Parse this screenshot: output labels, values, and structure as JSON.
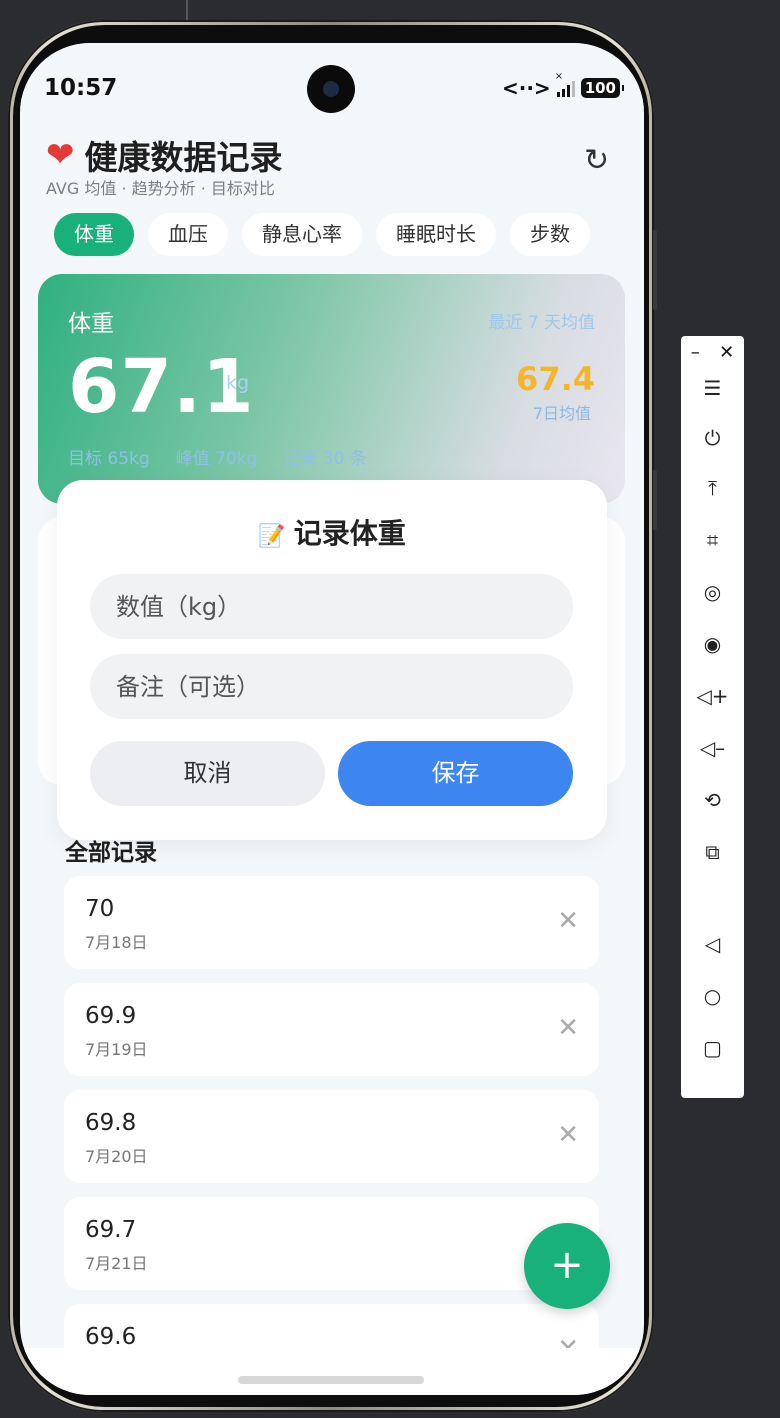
{
  "status": {
    "time": "10:57",
    "network": "<··>",
    "signal_x": "×",
    "battery": "100"
  },
  "header": {
    "heart": "❤",
    "title": "健康数据记录",
    "subtitle": "AVG 均值 · 趋势分析 · 目标对比",
    "refresh_icon": "↻"
  },
  "tabs": [
    {
      "label": "体重",
      "active": true
    },
    {
      "label": "血压",
      "active": false
    },
    {
      "label": "静息心率",
      "active": false
    },
    {
      "label": "睡眠时长",
      "active": false
    },
    {
      "label": "步数",
      "active": false
    }
  ],
  "summary": {
    "label": "体重",
    "recent": "最近 7 天均值",
    "value": "67.1",
    "unit": "kg",
    "avg": "67.4",
    "avg_label": "7日均值",
    "target": "目标 65kg",
    "peak": "峰值 70kg",
    "count": "记录 30 条"
  },
  "modal": {
    "icon": "📝",
    "title": "记录体重",
    "value_placeholder": "数值（kg）",
    "note_placeholder": "备注（可选）",
    "cancel": "取消",
    "save": "保存"
  },
  "records": {
    "title": "全部记录",
    "items": [
      {
        "value": "70",
        "date": "7月18日"
      },
      {
        "value": "69.9",
        "date": "7月19日"
      },
      {
        "value": "69.8",
        "date": "7月20日"
      },
      {
        "value": "69.7",
        "date": "7月21日"
      },
      {
        "value": "69.6",
        "date": ""
      }
    ]
  },
  "fab": "+",
  "toolbar": {
    "minimize": "–",
    "close": "✕",
    "items": [
      "☰",
      "⏻",
      "⤒",
      "⌗",
      "◎",
      "◉",
      "◁+",
      "◁–",
      "⟲",
      "⧉",
      "◁",
      "○",
      "▢"
    ]
  },
  "colors": {
    "accent_green": "#18b07b",
    "save_blue": "#3d85f0",
    "avg_yellow": "#f5b52b",
    "heart_red": "#e53935"
  }
}
